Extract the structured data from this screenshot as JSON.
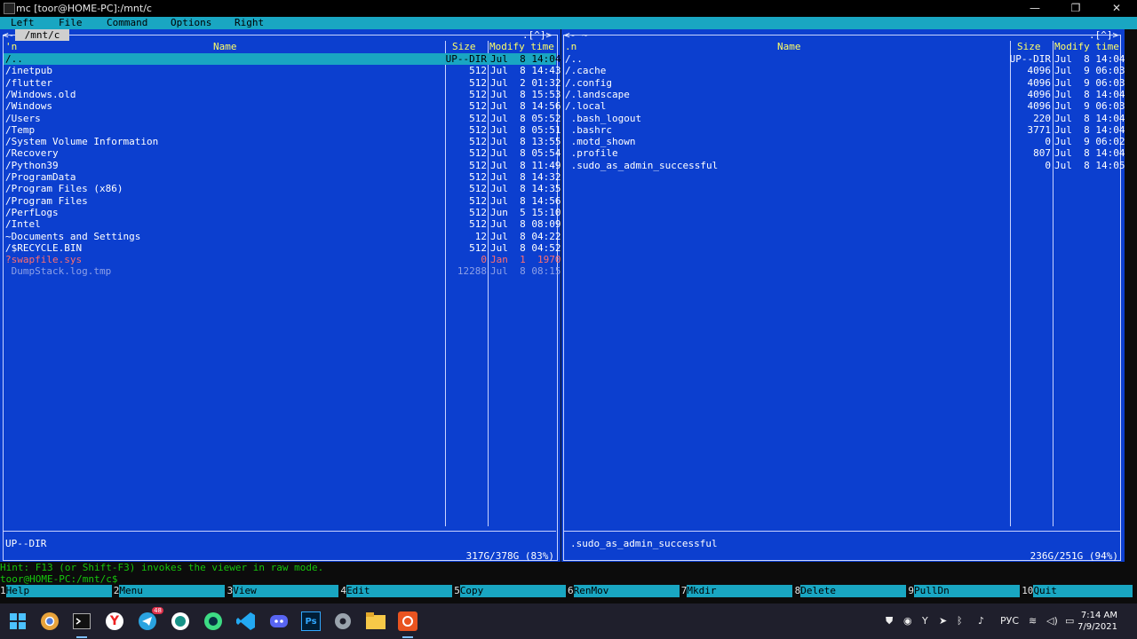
{
  "window": {
    "title": "mc [toor@HOME-PC]:/mnt/c",
    "minimize": "—",
    "maximize": "❐",
    "close": "✕"
  },
  "menu": [
    "Left",
    "File",
    "Command",
    "Options",
    "Right"
  ],
  "left_panel": {
    "path": " /mnt/c ",
    "corner_left": "<-",
    "corner_right": ".[^]>",
    "headers": {
      "sort": "'n",
      "name": "Name",
      "size": "Size",
      "modify": "Modify time"
    },
    "rows": [
      {
        "name": "/..",
        "size": "UP--DIR",
        "date": "Jul  8 14:04",
        "style": "sel"
      },
      {
        "name": "/inetpub",
        "size": "512",
        "date": "Jul  8 14:43",
        "style": ""
      },
      {
        "name": "/flutter",
        "size": "512",
        "date": "Jul  2 01:32",
        "style": ""
      },
      {
        "name": "/Windows.old",
        "size": "512",
        "date": "Jul  8 15:53",
        "style": ""
      },
      {
        "name": "/Windows",
        "size": "512",
        "date": "Jul  8 14:56",
        "style": ""
      },
      {
        "name": "/Users",
        "size": "512",
        "date": "Jul  8 05:52",
        "style": ""
      },
      {
        "name": "/Temp",
        "size": "512",
        "date": "Jul  8 05:51",
        "style": ""
      },
      {
        "name": "/System Volume Information",
        "size": "512",
        "date": "Jul  8 13:55",
        "style": ""
      },
      {
        "name": "/Recovery",
        "size": "512",
        "date": "Jul  8 05:54",
        "style": ""
      },
      {
        "name": "/Python39",
        "size": "512",
        "date": "Jul  8 11:49",
        "style": ""
      },
      {
        "name": "/ProgramData",
        "size": "512",
        "date": "Jul  8 14:32",
        "style": ""
      },
      {
        "name": "/Program Files (x86)",
        "size": "512",
        "date": "Jul  8 14:35",
        "style": ""
      },
      {
        "name": "/Program Files",
        "size": "512",
        "date": "Jul  8 14:56",
        "style": ""
      },
      {
        "name": "/PerfLogs",
        "size": "512",
        "date": "Jun  5 15:10",
        "style": ""
      },
      {
        "name": "/Intel",
        "size": "512",
        "date": "Jul  8 08:09",
        "style": ""
      },
      {
        "name": "~Documents and Settings",
        "size": "12",
        "date": "Jul  8 04:22",
        "style": ""
      },
      {
        "name": "/$RECYCLE.BIN",
        "size": "512",
        "date": "Jul  8 04:52",
        "style": ""
      },
      {
        "name": "?swapfile.sys",
        "size": "0",
        "date": "Jan  1  1970",
        "style": "red"
      },
      {
        "name": " DumpStack.log.tmp",
        "size": "12288",
        "date": "Jul  8 08:15",
        "style": "dim"
      }
    ],
    "status": "UP--DIR",
    "disk": " 317G/378G (83%) "
  },
  "right_panel": {
    "path": "~",
    "corner_left": "<-",
    "corner_right": ".[^]>",
    "headers": {
      "sort": ".n",
      "name": "Name",
      "size": "Size",
      "modify": "Modify time"
    },
    "rows": [
      {
        "name": "/..",
        "size": "UP--DIR",
        "date": "Jul  8 14:04",
        "style": ""
      },
      {
        "name": "/.cache",
        "size": "4096",
        "date": "Jul  9 06:03",
        "style": ""
      },
      {
        "name": "/.config",
        "size": "4096",
        "date": "Jul  9 06:03",
        "style": ""
      },
      {
        "name": "/.landscape",
        "size": "4096",
        "date": "Jul  8 14:04",
        "style": ""
      },
      {
        "name": "/.local",
        "size": "4096",
        "date": "Jul  9 06:03",
        "style": ""
      },
      {
        "name": " .bash_logout",
        "size": "220",
        "date": "Jul  8 14:04",
        "style": ""
      },
      {
        "name": " .bashrc",
        "size": "3771",
        "date": "Jul  8 14:04",
        "style": ""
      },
      {
        "name": " .motd_shown",
        "size": "0",
        "date": "Jul  9 06:02",
        "style": ""
      },
      {
        "name": " .profile",
        "size": "807",
        "date": "Jul  8 14:04",
        "style": ""
      },
      {
        "name": " .sudo_as_admin_successful",
        "size": "0",
        "date": "Jul  8 14:05",
        "style": ""
      }
    ],
    "status": ".sudo_as_admin_successful",
    "disk": " 236G/251G (94%) "
  },
  "hint": "Hint: F13 (or Shift-F3) invokes the viewer in raw mode.",
  "prompt": "toor@HOME-PC:/mnt/c$ ",
  "fkeys": [
    {
      "n": "1",
      "label": "Help"
    },
    {
      "n": "2",
      "label": "Menu"
    },
    {
      "n": "3",
      "label": "View"
    },
    {
      "n": "4",
      "label": "Edit"
    },
    {
      "n": "5",
      "label": "Copy"
    },
    {
      "n": "6",
      "label": "RenMov"
    },
    {
      "n": "7",
      "label": "Mkdir"
    },
    {
      "n": "8",
      "label": "Delete"
    },
    {
      "n": "9",
      "label": "PullDn"
    },
    {
      "n": "10",
      "label": "Quit"
    }
  ],
  "taskbar": {
    "apps": [
      "windows-start-icon",
      "chrome-canary-icon",
      "terminal-icon",
      "yandex-browser-icon",
      "telegram-icon",
      "gitkraken-icon",
      "android-studio-icon",
      "vscode-icon",
      "discord-icon",
      "photoshop-icon",
      "settings-icon",
      "file-explorer-icon",
      "ubuntu-icon"
    ],
    "telegram_badge": "48",
    "ps_label": "Ps",
    "yandex_label": "Y",
    "ubuntu_label": "◉",
    "tray_lang": "РУС",
    "time": "7:14 AM",
    "date": "7/9/2021"
  },
  "colors": {
    "panel_bg": "#0c3fcf",
    "cyan": "#19a6c2",
    "header_yellow": "#ffff66",
    "prompt_green": "#16c60c",
    "red_entry": "#ff6e6e"
  }
}
